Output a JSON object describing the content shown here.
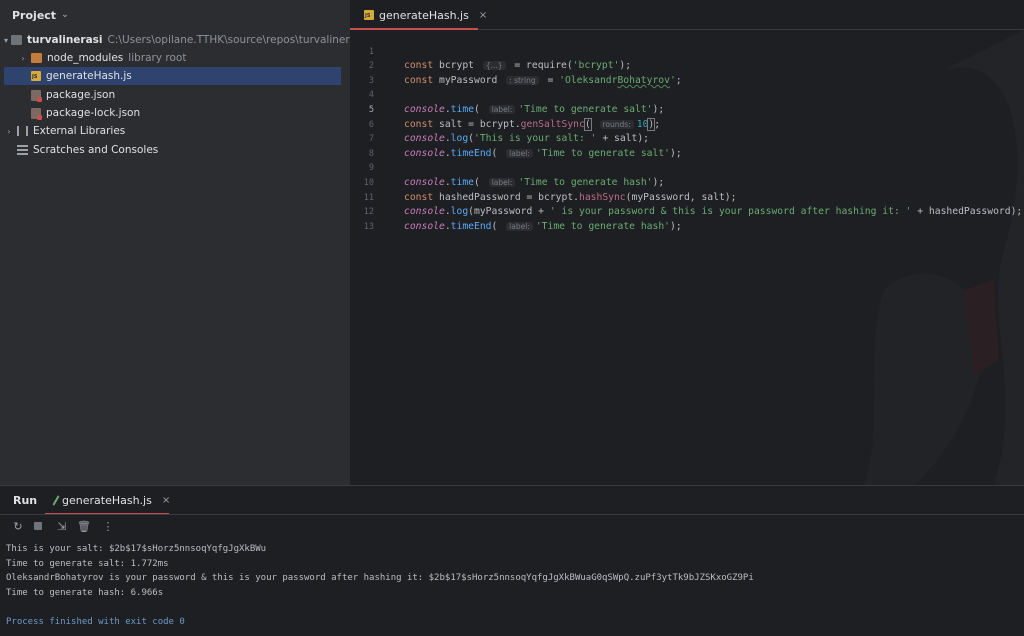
{
  "project_panel": {
    "title": "Project",
    "tree": [
      {
        "label": "turvalinerasi",
        "path": "C:\\Users\\opilane.TTHK\\source\\repos\\turvalinerasi",
        "type": "folder"
      },
      {
        "label": "node_modules",
        "note": "library root",
        "type": "folder-orange"
      },
      {
        "label": "generateHash.js",
        "type": "js",
        "selected": true
      },
      {
        "label": "package.json",
        "type": "json"
      },
      {
        "label": "package-lock.json",
        "type": "json"
      },
      {
        "label": "External Libraries",
        "type": "library"
      },
      {
        "label": "Scratches and Consoles",
        "type": "scratch"
      }
    ]
  },
  "editor": {
    "tab": {
      "label": "generateHash.js",
      "close": "×"
    },
    "line_numbers": [
      "1",
      "2",
      "3",
      "4",
      "5",
      "6",
      "7",
      "8",
      "9",
      "10",
      "11",
      "12",
      "13"
    ],
    "current_line": 5,
    "hints": {
      "require_hint": "{...}",
      "type_hint": ": string",
      "label_hint": "label:",
      "rounds_hint": "rounds:"
    }
  },
  "run_panel": {
    "title": "Run",
    "tab": {
      "label": "generateHash.js",
      "close": "×"
    },
    "toolbar_icons": [
      "rerun-icon",
      "stop-icon",
      "scroll-to-end-icon",
      "trash-icon",
      "more-icon"
    ],
    "output": [
      "This is your salt: $2b$17$sHorz5nnsoqYqfgJgXkBWu",
      "Time to generate salt: 1.772ms",
      "OleksandrBohatyrov is your password & this is your password after hashing it: $2b$17$sHorz5nnsoqYqfgJgXkBWuaG0qSWpQ.zuPf3ytTk9bJZSKxoGZ9Pi",
      "Time to generate hash: 6.966s",
      "",
      "Process finished with exit code 0"
    ]
  },
  "colors": {
    "background": "#1e1f22",
    "panel": "#2b2d30",
    "selection": "#2e436e",
    "accent_tab": "#c94f4f",
    "keyword": "#cf8e6d",
    "string": "#6aab73",
    "function": "#57aaf7",
    "number": "#2aacb8"
  }
}
